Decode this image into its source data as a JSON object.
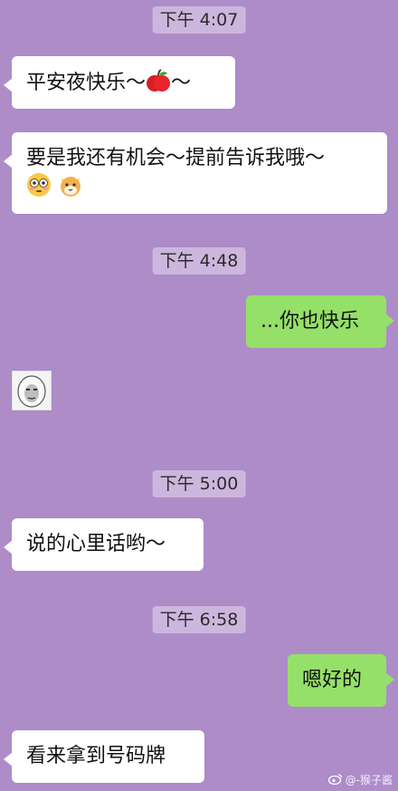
{
  "background_color": "#ad8cc8",
  "timestamps": [
    "下午 4:07",
    "下午 4:48",
    "下午 5:00",
    "下午 6:58"
  ],
  "messages": [
    {
      "side": "incoming",
      "text": "平安夜快乐～",
      "emoji_after": "apple-emoji",
      "suffix": "～"
    },
    {
      "side": "incoming",
      "line1": "要是我还有机会～提前告诉我哦～",
      "emojis": [
        "flushed-face-emoji",
        "cat-face-emoji"
      ]
    },
    {
      "side": "outgoing",
      "text": "...你也快乐"
    },
    {
      "side": "incoming",
      "sticker": "meme-face-sticker"
    },
    {
      "side": "incoming",
      "text": "说的心里话哟～"
    },
    {
      "side": "outgoing",
      "text": "嗯好的"
    },
    {
      "side": "incoming",
      "text": "看来拿到号码牌"
    }
  ],
  "watermark": {
    "icon": "weibo-icon",
    "text": "@-猴子酱"
  },
  "colors": {
    "incoming_bubble": "#ffffff",
    "outgoing_bubble": "#95e069",
    "timestamp_bg": "#ccb6de"
  }
}
